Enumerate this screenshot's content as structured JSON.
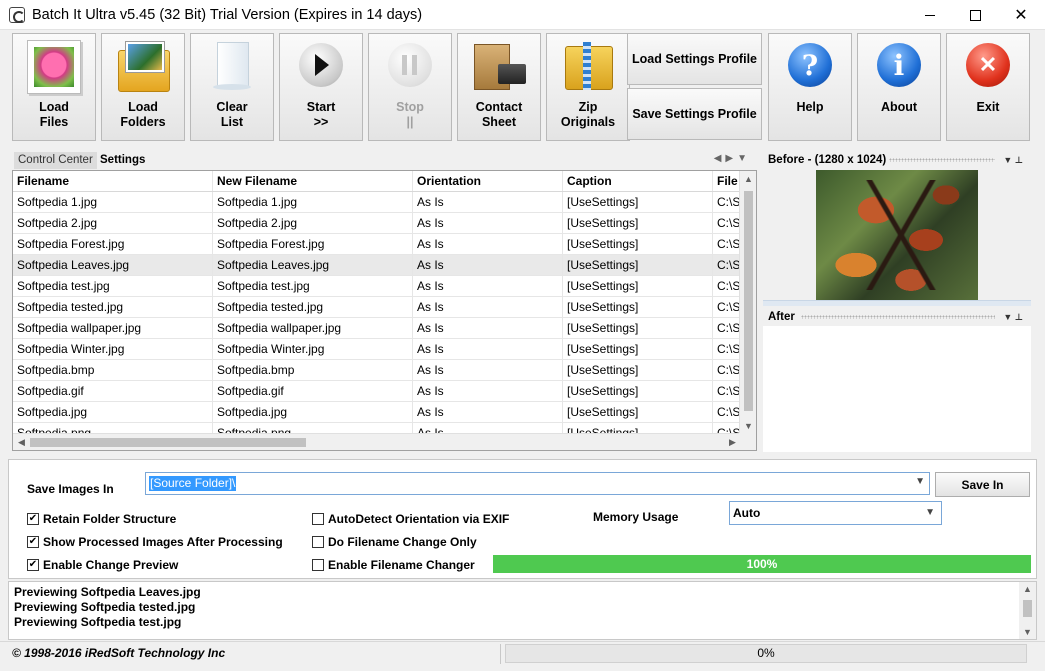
{
  "window": {
    "title": "Batch It Ultra v5.45 (32 Bit) Trial Version (Expires in 14 days)"
  },
  "toolbar": {
    "load_files": "Load\nFiles",
    "load_folders": "Load\nFolders",
    "clear_list": "Clear\nList",
    "start": "Start\n>>",
    "stop": "Stop\n||",
    "contact_sheet": "Contact\nSheet",
    "zip_originals": "Zip\nOriginals",
    "load_settings_profile": "Load Settings Profile",
    "save_settings_profile": "Save Settings Profile",
    "help": "Help",
    "about": "About",
    "exit": "Exit",
    "help_glyph": "?",
    "about_glyph": "i",
    "exit_glyph": "✕"
  },
  "tabs": {
    "control_center": "Control Center",
    "settings": "Settings"
  },
  "grid": {
    "columns": [
      "Filename",
      "New Filename",
      "Orientation",
      "Caption",
      "File"
    ],
    "rows": [
      [
        "Softpedia 1.jpg",
        "Softpedia 1.jpg",
        "As Is",
        "[UseSettings]",
        "C:\\S"
      ],
      [
        "Softpedia 2.jpg",
        "Softpedia 2.jpg",
        "As Is",
        "[UseSettings]",
        "C:\\S"
      ],
      [
        "Softpedia Forest.jpg",
        "Softpedia Forest.jpg",
        "As Is",
        "[UseSettings]",
        "C:\\S"
      ],
      [
        "Softpedia Leaves.jpg",
        "Softpedia Leaves.jpg",
        "As Is",
        "[UseSettings]",
        "C:\\S"
      ],
      [
        "Softpedia test.jpg",
        "Softpedia test.jpg",
        "As Is",
        "[UseSettings]",
        "C:\\S"
      ],
      [
        "Softpedia tested.jpg",
        "Softpedia tested.jpg",
        "As Is",
        "[UseSettings]",
        "C:\\S"
      ],
      [
        "Softpedia wallpaper.jpg",
        "Softpedia wallpaper.jpg",
        "As Is",
        "[UseSettings]",
        "C:\\S"
      ],
      [
        "Softpedia Winter.jpg",
        "Softpedia Winter.jpg",
        "As Is",
        "[UseSettings]",
        "C:\\S"
      ],
      [
        "Softpedia.bmp",
        "Softpedia.bmp",
        "As Is",
        "[UseSettings]",
        "C:\\S"
      ],
      [
        "Softpedia.gif",
        "Softpedia.gif",
        "As Is",
        "[UseSettings]",
        "C:\\S"
      ],
      [
        "Softpedia.jpg",
        "Softpedia.jpg",
        "As Is",
        "[UseSettings]",
        "C:\\S"
      ],
      [
        "Softpedia.png",
        "Softpedia.png",
        "As Is",
        "[UseSettings]",
        "C:\\S"
      ]
    ],
    "selected_row": 3
  },
  "preview": {
    "before_label": "Before - (1280 x 1024)",
    "after_label": "After"
  },
  "settings": {
    "save_images_in_label": "Save Images In",
    "save_path": "[Source Folder]\\",
    "save_in_button": "Save In",
    "retain_folder_structure": "Retain Folder Structure",
    "show_processed": "Show Processed Images After Processing",
    "enable_change_preview": "Enable Change Preview",
    "autodetect_orientation": "AutoDetect Orientation via EXIF",
    "filename_change_only": "Do Filename Change Only",
    "enable_filename_changer": "Enable Filename Changer",
    "memory_usage_label": "Memory Usage",
    "memory_usage_value": "Auto",
    "progress_text": "100%",
    "progress_value": 100,
    "check_mark": "✔"
  },
  "log": {
    "lines": [
      "Previewing Softpedia Leaves.jpg",
      "Previewing Softpedia tested.jpg",
      "Previewing Softpedia test.jpg"
    ]
  },
  "status": {
    "copyright": "© 1998-2016 iRedSoft Technology Inc",
    "progress_text": "0%",
    "progress_value": 0
  },
  "colors": {
    "progress_green": "#4fc950",
    "selection_blue": "#3399ff"
  }
}
